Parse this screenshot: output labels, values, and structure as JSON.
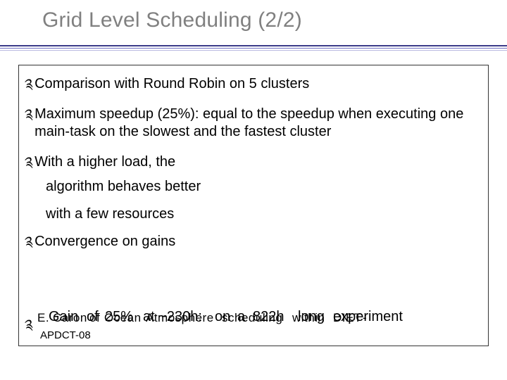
{
  "title": "Grid Level Scheduling (2/2)",
  "bullets": {
    "b1": "Comparison with Round Robin on 5 clusters",
    "b2": "Maximum speedup (25%): equal to the speedup when executing one main-task on the slowest and the fastest cluster",
    "b3": "With a higher load, the",
    "b3_sub1": "algorithm behaves better",
    "b3_sub2": "with a few resources",
    "b4": "Convergence on gains"
  },
  "overlap": {
    "layer_a_prefix": "E.",
    "layer_a_mid": "Caron",
    "layer_b_word1": "Gain",
    "layer_b_word2": "of",
    "layer_a_seg1": "of",
    "layer_a_seg2": "Ocean",
    "layer_b_seg1": "25%",
    "layer_a_seg3": "Atmosphere",
    "layer_b_seg2": "at ~230h:",
    "layer_b_seg3": "on",
    "layer_a_seg4": "scheduling",
    "layer_b_seg4": "a",
    "layer_b_seg5": "822h",
    "layer_a_seg5": "within",
    "layer_b_seg6": "long",
    "layer_a_seg6": "DIET",
    "layer_b_seg7": "experiment",
    "layer_a_seg7": "-"
  },
  "footer": "APDCT-08",
  "bullet_glyph": "༉"
}
